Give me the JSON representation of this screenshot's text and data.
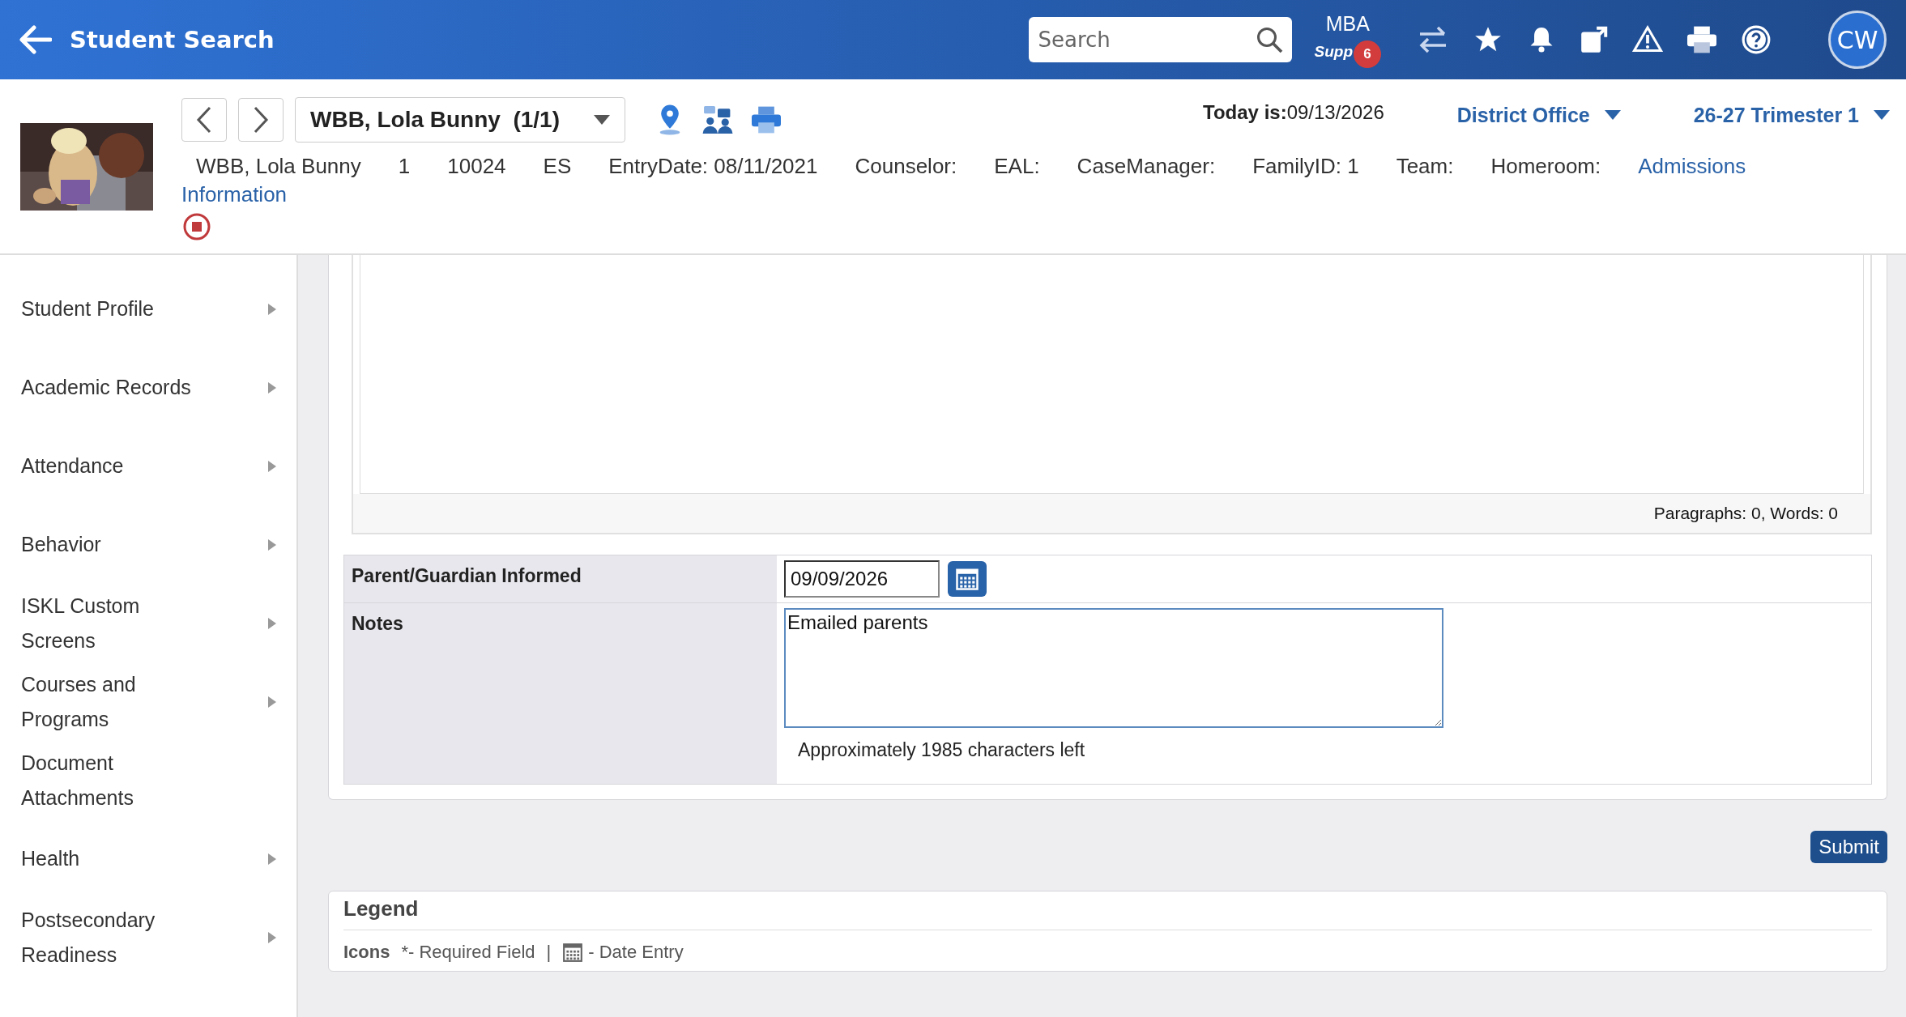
{
  "header": {
    "back_label": "Student Search",
    "search": {
      "placeholder": "Search"
    },
    "support": {
      "line1": "MBA",
      "line2": "Supp",
      "badge": "6"
    },
    "avatar": "CW"
  },
  "student": {
    "selector": "WBB, Lola Bunny  (1/1)",
    "today_label": "Today is:",
    "today": "09/13/2026",
    "school": "District Office",
    "term": "26-27 Trimester 1",
    "info": [
      "WBB, Lola Bunny",
      "1",
      "10024",
      "ES",
      "EntryDate: 08/11/2021",
      "Counselor:",
      "EAL:",
      "CaseManager:",
      "FamilyID: 1",
      "Team:",
      "Homeroom:"
    ],
    "link_lines": [
      "Admissions",
      "Information"
    ]
  },
  "sidebar": {
    "items": [
      {
        "label": "Student Profile",
        "expandable": true
      },
      {
        "label": "Academic Records",
        "expandable": true
      },
      {
        "label": "Attendance",
        "expandable": true
      },
      {
        "label": "Behavior",
        "expandable": true
      },
      {
        "label": "ISKL Custom Screens",
        "expandable": true
      },
      {
        "label": "Courses and Programs",
        "expandable": true
      },
      {
        "label": "Document Attachments",
        "expandable": false
      },
      {
        "label": "Health",
        "expandable": true
      },
      {
        "label": "Postsecondary Readiness",
        "expandable": true
      }
    ]
  },
  "form": {
    "editor_status": "Paragraphs: 0, Words: 0",
    "rows": [
      {
        "label": "Parent/Guardian Informed",
        "kind": "date",
        "value": "09/09/2026"
      },
      {
        "label": "Notes",
        "kind": "textarea",
        "value": "Emailed parents",
        "hint": "Approximately 1985 characters left"
      }
    ],
    "submit": "Submit"
  },
  "legend": {
    "title": "Legend",
    "icons_label": "Icons",
    "required": "*- Required Field",
    "separator": "|",
    "date": "- Date Entry"
  }
}
